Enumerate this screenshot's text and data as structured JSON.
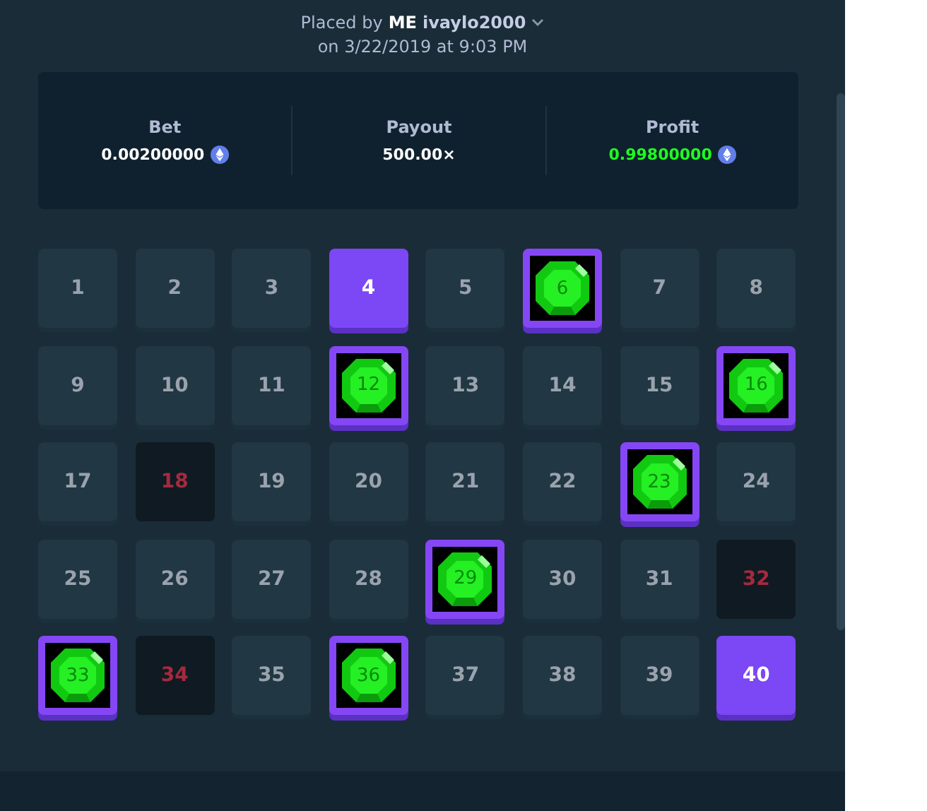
{
  "header": {
    "prefix": "Placed by",
    "badge": "ME",
    "user": "ivaylo2000",
    "date": "on 3/22/2019 at 9:03 PM"
  },
  "stats": [
    {
      "label": "Bet",
      "value": "0.00200000",
      "currency": true,
      "positive": false
    },
    {
      "label": "Payout",
      "value": "500.00×",
      "currency": false,
      "positive": false
    },
    {
      "label": "Profit",
      "value": "0.99800000",
      "currency": true,
      "positive": true
    }
  ],
  "tiles": [
    {
      "number": "1",
      "kind": "plain"
    },
    {
      "number": "2",
      "kind": "plain"
    },
    {
      "number": "3",
      "kind": "plain"
    },
    {
      "number": "4",
      "kind": "picked"
    },
    {
      "number": "5",
      "kind": "plain"
    },
    {
      "number": "6",
      "kind": "gem"
    },
    {
      "number": "7",
      "kind": "plain"
    },
    {
      "number": "8",
      "kind": "plain"
    },
    {
      "number": "9",
      "kind": "plain"
    },
    {
      "number": "10",
      "kind": "plain"
    },
    {
      "number": "11",
      "kind": "plain"
    },
    {
      "number": "12",
      "kind": "gem"
    },
    {
      "number": "13",
      "kind": "plain"
    },
    {
      "number": "14",
      "kind": "plain"
    },
    {
      "number": "15",
      "kind": "plain"
    },
    {
      "number": "16",
      "kind": "gem"
    },
    {
      "number": "17",
      "kind": "plain"
    },
    {
      "number": "18",
      "kind": "miss"
    },
    {
      "number": "19",
      "kind": "plain"
    },
    {
      "number": "20",
      "kind": "plain"
    },
    {
      "number": "21",
      "kind": "plain"
    },
    {
      "number": "22",
      "kind": "plain"
    },
    {
      "number": "23",
      "kind": "gem"
    },
    {
      "number": "24",
      "kind": "plain"
    },
    {
      "number": "25",
      "kind": "plain"
    },
    {
      "number": "26",
      "kind": "plain"
    },
    {
      "number": "27",
      "kind": "plain"
    },
    {
      "number": "28",
      "kind": "plain"
    },
    {
      "number": "29",
      "kind": "gem"
    },
    {
      "number": "30",
      "kind": "plain"
    },
    {
      "number": "31",
      "kind": "plain"
    },
    {
      "number": "32",
      "kind": "miss"
    },
    {
      "number": "33",
      "kind": "gem"
    },
    {
      "number": "34",
      "kind": "miss"
    },
    {
      "number": "35",
      "kind": "plain"
    },
    {
      "number": "36",
      "kind": "gem"
    },
    {
      "number": "37",
      "kind": "plain"
    },
    {
      "number": "38",
      "kind": "plain"
    },
    {
      "number": "39",
      "kind": "plain"
    },
    {
      "number": "40",
      "kind": "picked"
    }
  ]
}
